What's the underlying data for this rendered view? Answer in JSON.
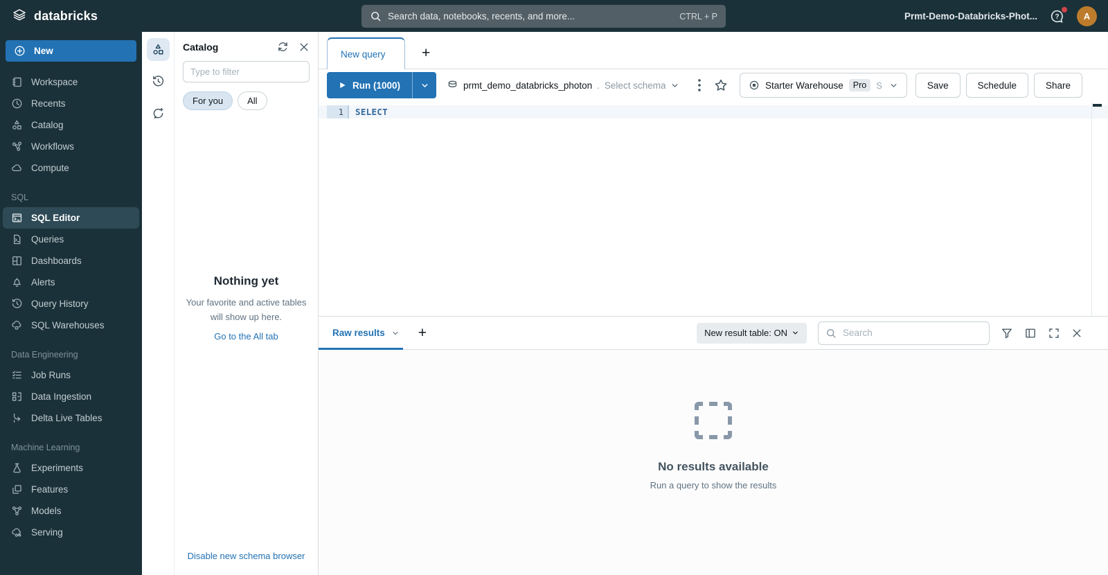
{
  "topbar": {
    "logo_text": "databricks",
    "search": {
      "placeholder": "Search data, notebooks, recents, and more...",
      "shortcut": "CTRL + P"
    },
    "workspace_name": "Prmt-Demo-Databricks-Phot...",
    "avatar_initial": "A"
  },
  "sidebar": {
    "new_button": "New",
    "main_items": [
      {
        "label": "Workspace"
      },
      {
        "label": "Recents"
      },
      {
        "label": "Catalog"
      },
      {
        "label": "Workflows"
      },
      {
        "label": "Compute"
      }
    ],
    "sql_section": {
      "title": "SQL",
      "items": [
        {
          "label": "SQL Editor"
        },
        {
          "label": "Queries"
        },
        {
          "label": "Dashboards"
        },
        {
          "label": "Alerts"
        },
        {
          "label": "Query History"
        },
        {
          "label": "SQL Warehouses"
        }
      ]
    },
    "de_section": {
      "title": "Data Engineering",
      "items": [
        {
          "label": "Job Runs"
        },
        {
          "label": "Data Ingestion"
        },
        {
          "label": "Delta Live Tables"
        }
      ]
    },
    "ml_section": {
      "title": "Machine Learning",
      "items": [
        {
          "label": "Experiments"
        },
        {
          "label": "Features"
        },
        {
          "label": "Models"
        },
        {
          "label": "Serving"
        }
      ]
    }
  },
  "schema_browser": {
    "title": "Catalog",
    "filter_placeholder": "Type to filter",
    "tabs": [
      {
        "label": "For you"
      },
      {
        "label": "All"
      }
    ],
    "empty": {
      "title": "Nothing yet",
      "line1": "Your favorite and active tables",
      "line2": "will show up here.",
      "link": "Go to the All tab"
    },
    "footer_link": "Disable new schema browser"
  },
  "editor": {
    "tab_title": "New query",
    "run_label": "Run (1000)",
    "catalog_name": "prmt_demo_databricks_photon",
    "catalog_separator": ".",
    "schema_placeholder": "Select schema",
    "warehouse": {
      "name": "Starter Warehouse",
      "tier": "Pro",
      "size": "S"
    },
    "actions": {
      "save": "Save",
      "schedule": "Schedule",
      "share": "Share"
    },
    "code": {
      "line_number": "1",
      "line_text": "SELECT"
    }
  },
  "results": {
    "tab_label": "Raw results",
    "toggle_label": "New result table: ON",
    "search_placeholder": "Search",
    "empty": {
      "title": "No results available",
      "subtitle": "Run a query to show the results"
    }
  },
  "colors": {
    "accent_blue": "#2272b4",
    "topnav_dark": "#1b3139",
    "avatar_orange": "#bd7c2c",
    "alert_red": "#d2454b"
  }
}
